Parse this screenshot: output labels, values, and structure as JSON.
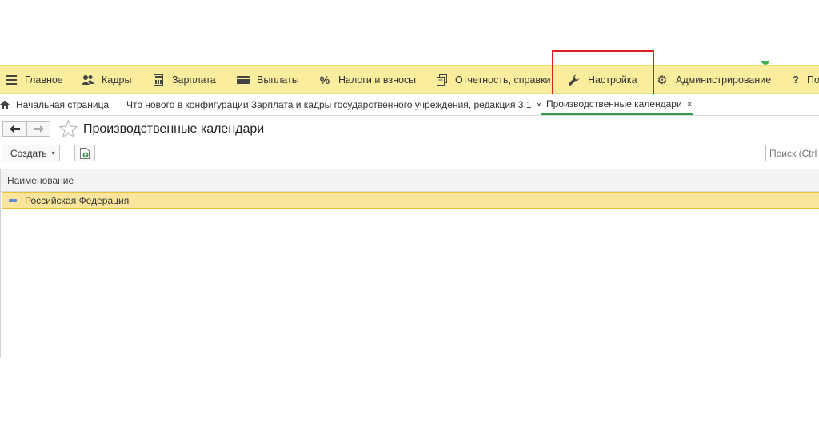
{
  "sections": {
    "items": [
      {
        "label": "Главное",
        "icon": "hamburger-menu-icon"
      },
      {
        "label": "Кадры",
        "icon": "people-icon"
      },
      {
        "label": "Зарплата",
        "icon": "calculator-icon"
      },
      {
        "label": "Выплаты",
        "icon": "wallet-icon"
      },
      {
        "label": "Налоги и взносы",
        "icon": "percent-icon"
      },
      {
        "label": "Отчетность, справки",
        "icon": "documents-icon"
      },
      {
        "label": "Настройка",
        "icon": "wrench-icon"
      },
      {
        "label": "Администрирование",
        "icon": "gear-icon"
      },
      {
        "label": "По",
        "icon": "help-icon"
      }
    ],
    "highlighted": "Настройка",
    "highlight_color": "#e02020"
  },
  "tabs": {
    "items": [
      {
        "label": "Начальная страница"
      },
      {
        "label": "Что нового в конфигурации Зарплата и кадры государственного учреждения, редакция 3.1",
        "close": "×"
      },
      {
        "label": "Производственные календари",
        "close": "×"
      }
    ],
    "active": "Производственные календари"
  },
  "page": {
    "title": "Производственные календари"
  },
  "toolbar": {
    "create_label": "Создать",
    "create_arrow": "▾",
    "search_placeholder": "Поиск (Ctrl+F)"
  },
  "table": {
    "header": "Наименование",
    "rows": [
      {
        "name": "Российская Федерация"
      }
    ]
  },
  "colors": {
    "section_panel_bg": "#fbed9e",
    "selected_row_bg": "#f9e59b",
    "active_tab_underline": "#3a9a4b"
  }
}
